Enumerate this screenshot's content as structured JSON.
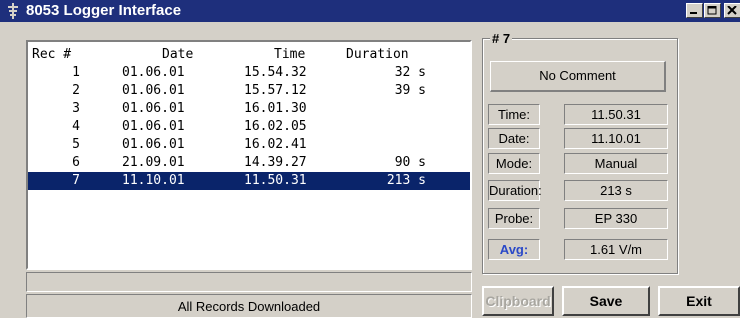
{
  "window": {
    "title": "8053 Logger Interface"
  },
  "columns": [
    "Rec #",
    "Date",
    "Time",
    "Duration"
  ],
  "records": [
    {
      "rec": "1",
      "date": "01.06.01",
      "time": "15.54.32",
      "duration": "32 s"
    },
    {
      "rec": "2",
      "date": "01.06.01",
      "time": "15.57.12",
      "duration": "39 s"
    },
    {
      "rec": "3",
      "date": "01.06.01",
      "time": "16.01.30",
      "duration": ""
    },
    {
      "rec": "4",
      "date": "01.06.01",
      "time": "16.02.05",
      "duration": ""
    },
    {
      "rec": "5",
      "date": "01.06.01",
      "time": "16.02.41",
      "duration": ""
    },
    {
      "rec": "6",
      "date": "21.09.01",
      "time": "14.39.27",
      "duration": "90 s"
    },
    {
      "rec": "7",
      "date": "11.10.01",
      "time": "11.50.31",
      "duration": "213 s"
    }
  ],
  "selected_record": "7",
  "status": "All Records Downloaded",
  "detail": {
    "group_label": "# 7",
    "comment": "No Comment",
    "fields": [
      {
        "label": "Time:",
        "value": "11.50.31"
      },
      {
        "label": "Date:",
        "value": "11.10.01"
      },
      {
        "label": "Mode:",
        "value": "Manual"
      },
      {
        "label": "Duration:",
        "value": "213 s"
      },
      {
        "label": "Probe:",
        "value": "EP 330"
      },
      {
        "label": "Avg:",
        "value": "1.61 V/m"
      }
    ]
  },
  "buttons": {
    "clipboard": "Clipboard",
    "save": "Save",
    "exit": "Exit"
  },
  "colors": {
    "titlebar": "#1e2f7c",
    "selection": "#0a246a",
    "avg_label": "#2a49c8",
    "face": "#d4d0c8"
  }
}
